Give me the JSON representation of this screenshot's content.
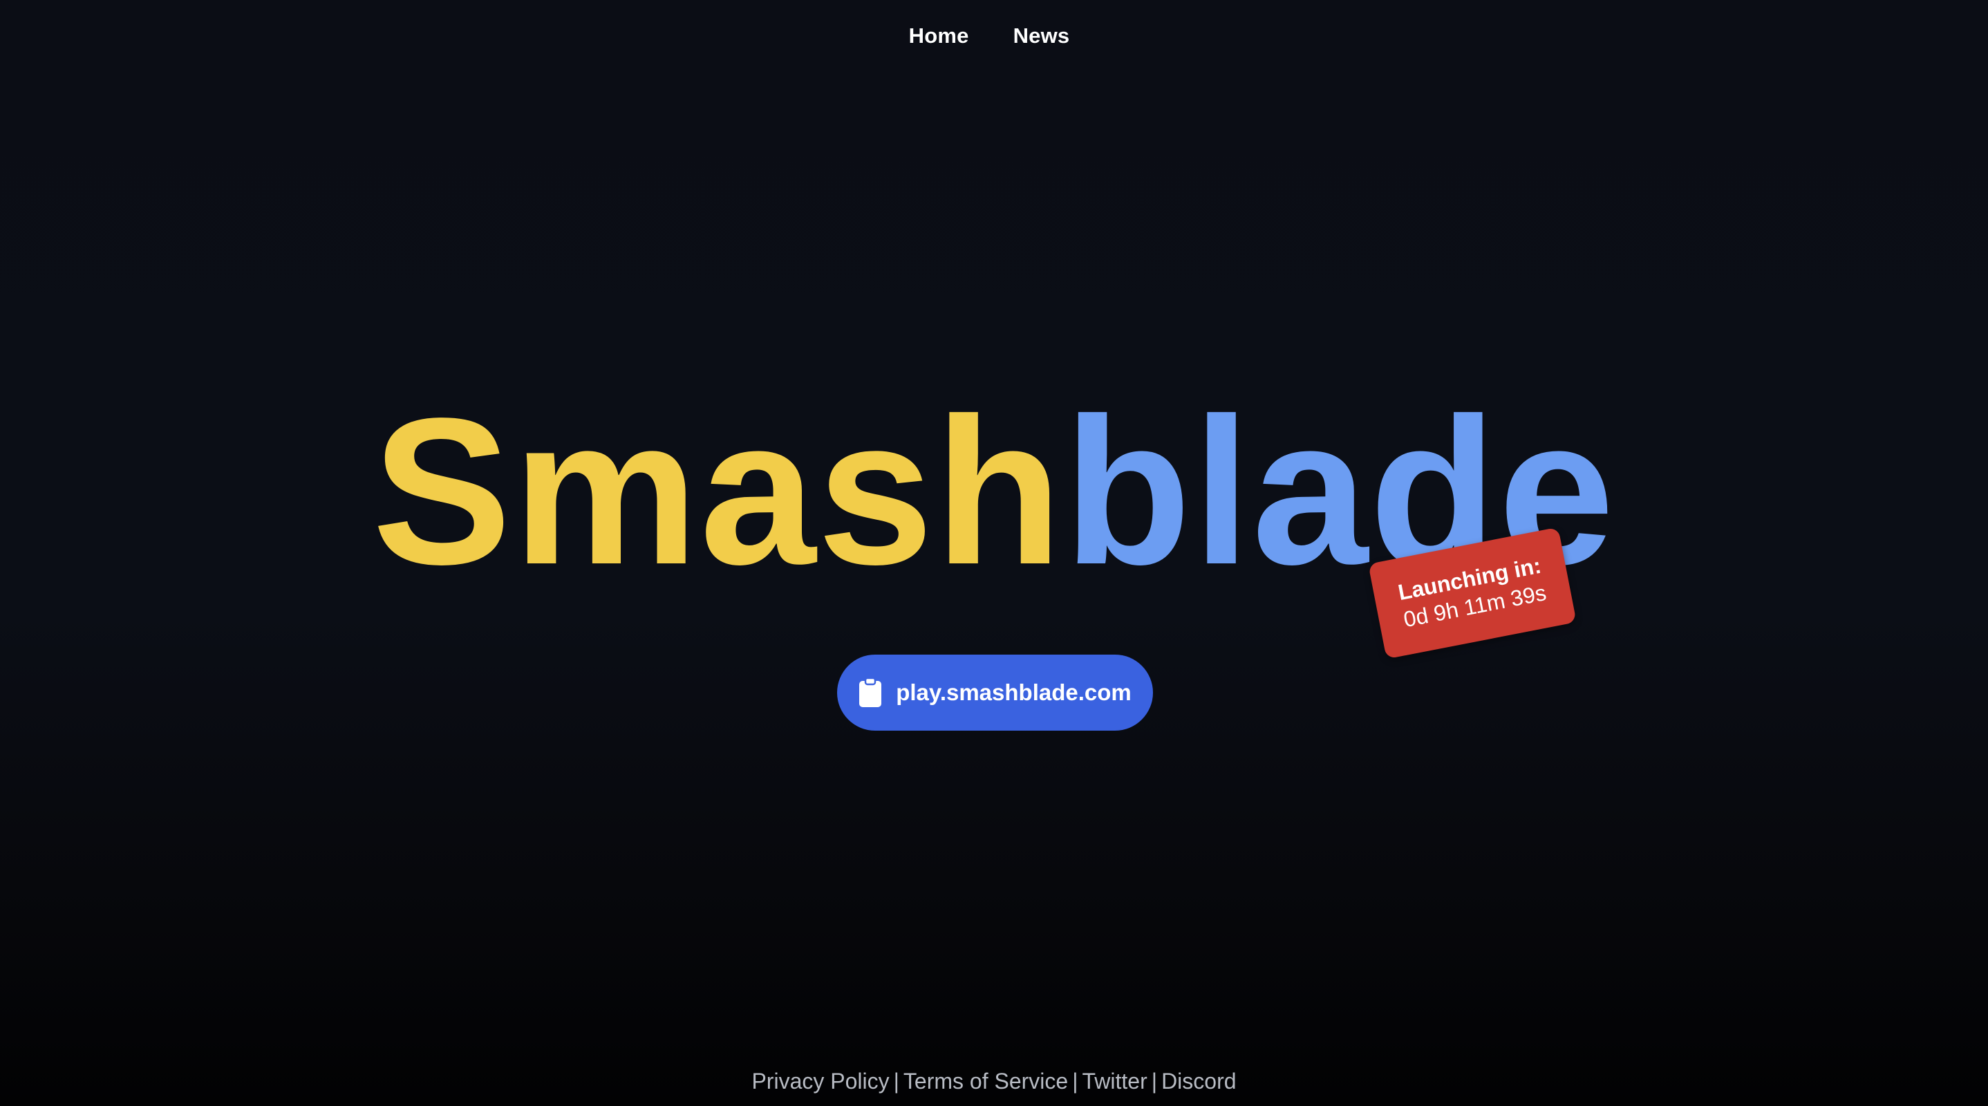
{
  "nav": {
    "items": [
      {
        "label": "Home"
      },
      {
        "label": "News"
      }
    ]
  },
  "hero": {
    "title_part_1": "Smash",
    "title_part_2": "blade",
    "title_color_1": "#f2cd4a",
    "title_color_2": "#6c9df2"
  },
  "countdown": {
    "label": "Launching in:",
    "value": "0d 9h 11m 39s",
    "color": "#cc3a30"
  },
  "server_button": {
    "icon": "clipboard-icon",
    "label": "play.smashblade.com",
    "color": "#3a62e0"
  },
  "footer": {
    "links": [
      {
        "label": "Privacy Policy"
      },
      {
        "label": "Terms of Service"
      },
      {
        "label": "Twitter"
      },
      {
        "label": "Discord"
      }
    ],
    "separator": "|"
  }
}
